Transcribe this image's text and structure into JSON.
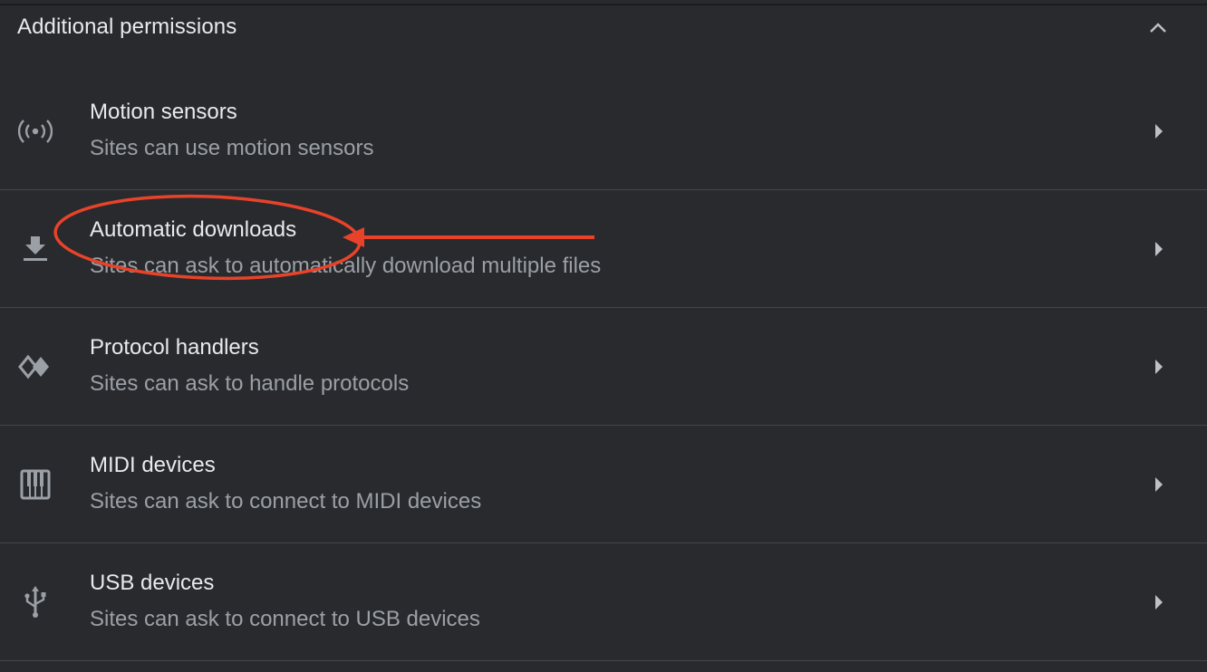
{
  "section": {
    "title": "Additional permissions"
  },
  "items": [
    {
      "label": "Motion sensors",
      "description": "Sites can use motion sensors",
      "icon": "motion-sensors-icon"
    },
    {
      "label": "Automatic downloads",
      "description": "Sites can ask to automatically download multiple files",
      "icon": "download-icon"
    },
    {
      "label": "Protocol handlers",
      "description": "Sites can ask to handle protocols",
      "icon": "protocol-handler-icon"
    },
    {
      "label": "MIDI devices",
      "description": "Sites can ask to connect to MIDI devices",
      "icon": "piano-icon"
    },
    {
      "label": "USB devices",
      "description": "Sites can ask to connect to USB devices",
      "icon": "usb-icon"
    }
  ],
  "colors": {
    "background": "#292a2d",
    "primary_text": "#e8eaed",
    "secondary_text": "#9aa0a6",
    "divider": "#45464a",
    "annotation": "#e8432a"
  }
}
